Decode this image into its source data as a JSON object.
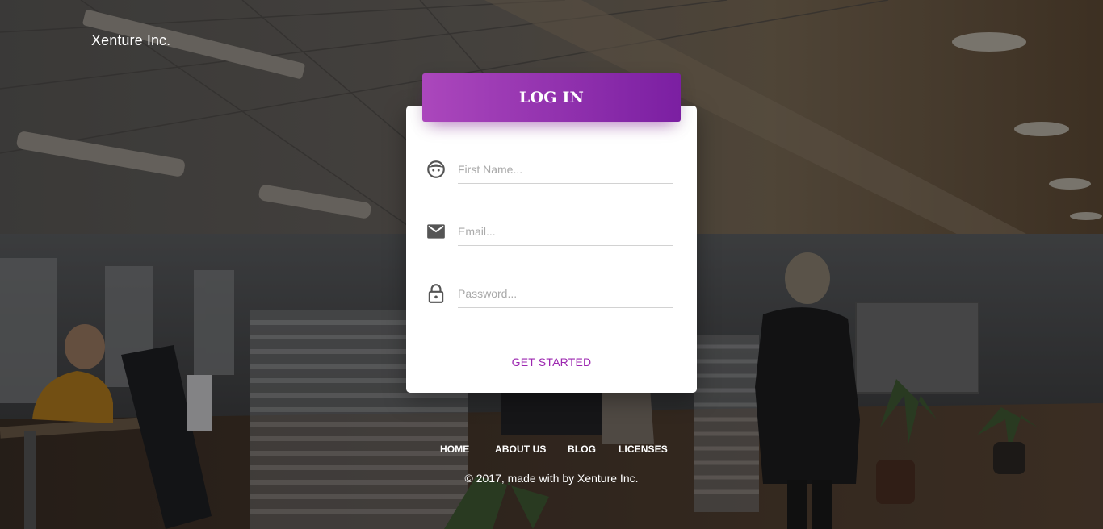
{
  "brand": {
    "name": "Xenture Inc."
  },
  "login_card": {
    "title": "LOG IN",
    "fields": [
      {
        "icon": "face-icon",
        "placeholder": "First Name...",
        "value": ""
      },
      {
        "icon": "mail-icon",
        "placeholder": "Email...",
        "value": ""
      },
      {
        "icon": "lock-icon",
        "placeholder": "Password...",
        "value": ""
      }
    ],
    "cta_label": "GET STARTED"
  },
  "footer": {
    "nav": [
      "HOME",
      "ABOUT US",
      "BLOG",
      "LICENSES"
    ],
    "copyright": "© 2017, made with by Xenture Inc."
  },
  "colors": {
    "accent_start": "#ab47bc",
    "accent_end": "#7b1fa2",
    "cta_text": "#9c27b0"
  }
}
